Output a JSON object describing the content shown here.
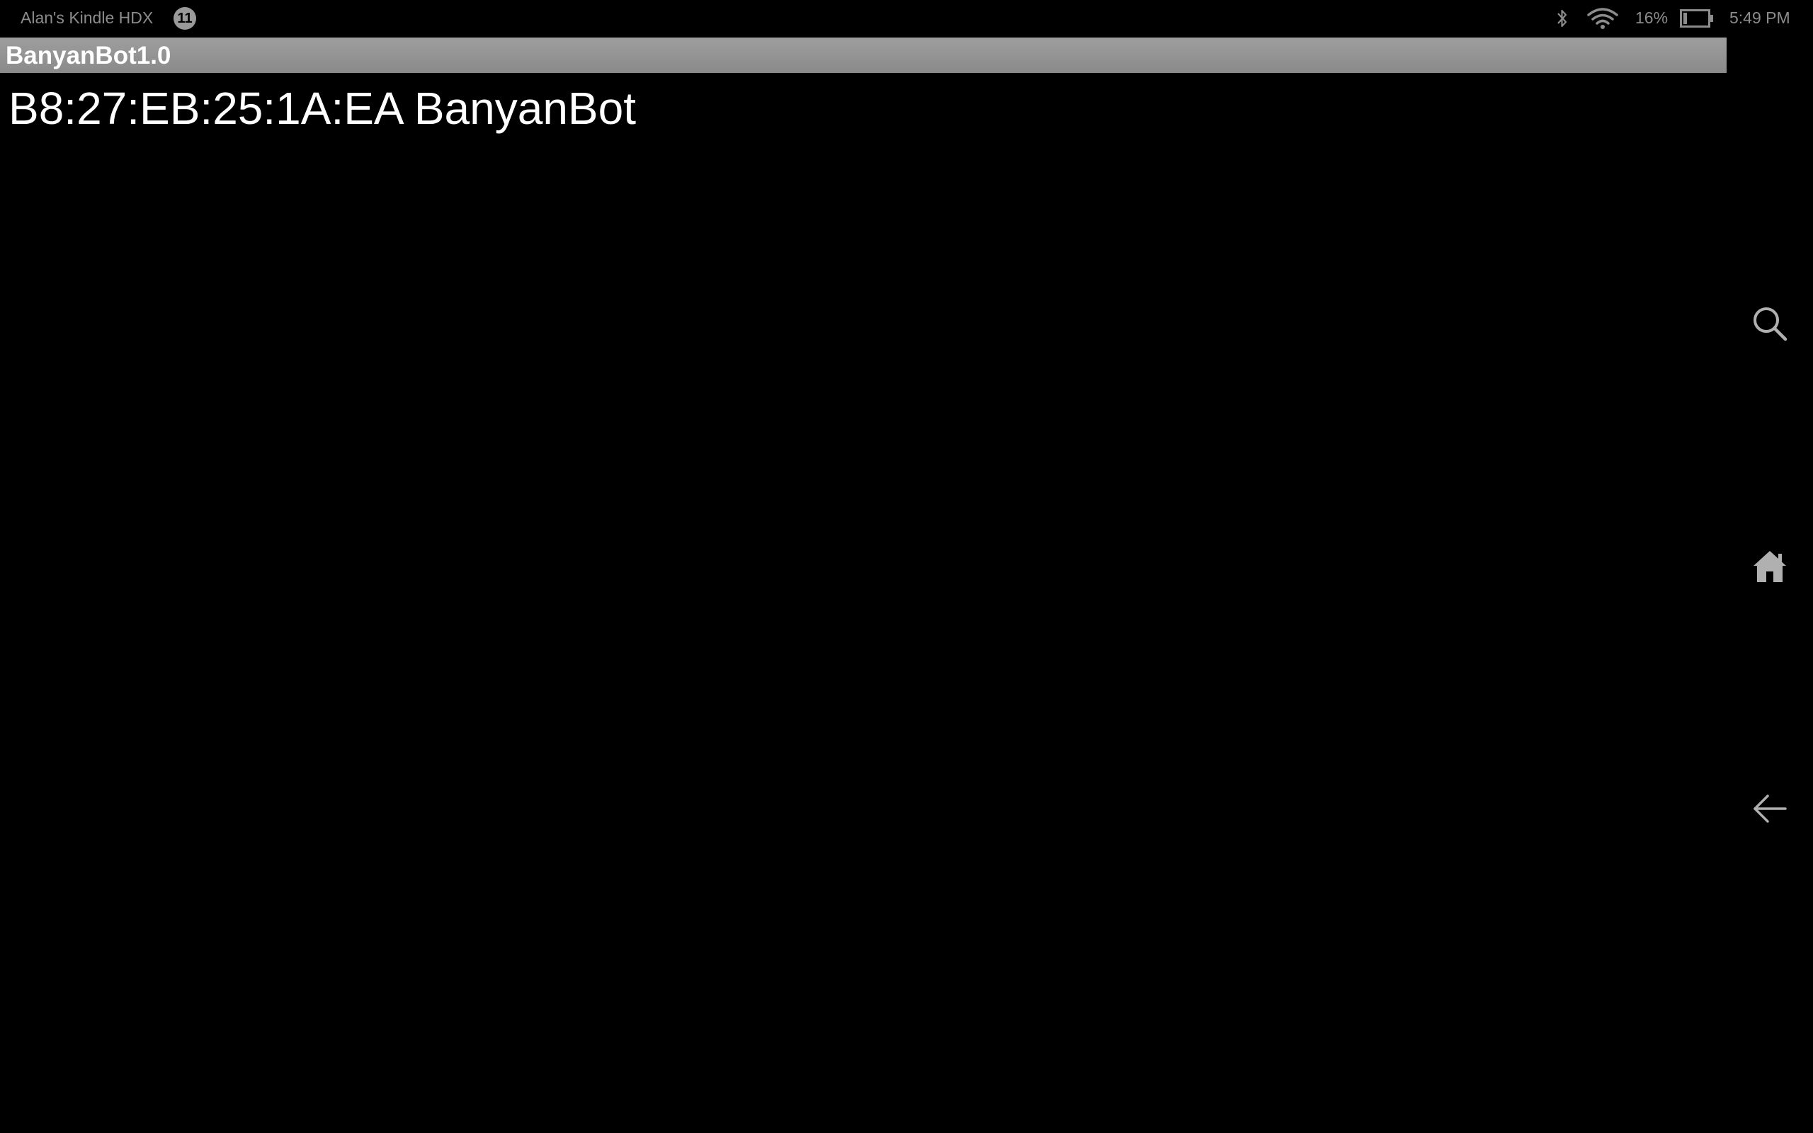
{
  "status_bar": {
    "device_name": "Alan's Kindle HDX",
    "notification_count": "11",
    "battery_percent": "16%",
    "battery_level": 0.16,
    "time": "5:49 PM",
    "icons": [
      "bluetooth-icon",
      "wifi-icon",
      "battery-icon"
    ]
  },
  "app": {
    "title": "BanyanBot1.0"
  },
  "devices": [
    {
      "label": "B8:27:EB:25:1A:EA BanyanBot"
    }
  ],
  "nav": {
    "icons": [
      "search-icon",
      "home-icon",
      "back-arrow-icon"
    ]
  },
  "colors": {
    "background": "#000000",
    "title_bar": "#9e9e9e",
    "status_text": "#8c8c8c",
    "text": "#ffffff"
  }
}
